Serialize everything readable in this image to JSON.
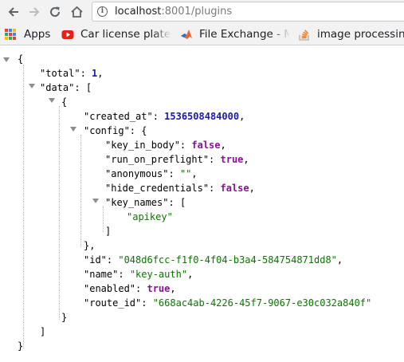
{
  "browser": {
    "url_host": "localhost",
    "url_rest": ":8001/plugins",
    "bookmarks": [
      {
        "label": "Apps"
      },
      {
        "label": "Car license plate"
      },
      {
        "label": "File Exchange - M"
      },
      {
        "label": "image processin"
      }
    ]
  },
  "json_view": {
    "open_root": "{",
    "total_key": "\"total\"",
    "total_value": "1",
    "data_key": "\"data\"",
    "open_array": "[",
    "open_item": "{",
    "created_at_key": "\"created_at\"",
    "created_at_value": "1536508484000",
    "config_key": "\"config\"",
    "open_config": "{",
    "key_in_body_key": "\"key_in_body\"",
    "key_in_body_value": "false",
    "run_on_preflight_key": "\"run_on_preflight\"",
    "run_on_preflight_value": "true",
    "anonymous_key": "\"anonymous\"",
    "anonymous_value": "\"\"",
    "hide_credentials_key": "\"hide_credentials\"",
    "hide_credentials_value": "false",
    "key_names_key": "\"key_names\"",
    "open_key_names": "[",
    "key_names_item": "\"apikey\"",
    "close_key_names": "]",
    "close_config": "},",
    "id_key": "\"id\"",
    "id_value": "\"048d6fcc-f1f0-4f04-b3a4-584754871dd8\"",
    "name_key": "\"name\"",
    "name_value": "\"key-auth\"",
    "enabled_key": "\"enabled\"",
    "enabled_value": "true",
    "route_id_key": "\"route_id\"",
    "route_id_value": "\"668ac4ab-4226-45f7-9067-e30c032a840f\"",
    "close_item": "}",
    "close_array": "]",
    "close_root": "}"
  }
}
